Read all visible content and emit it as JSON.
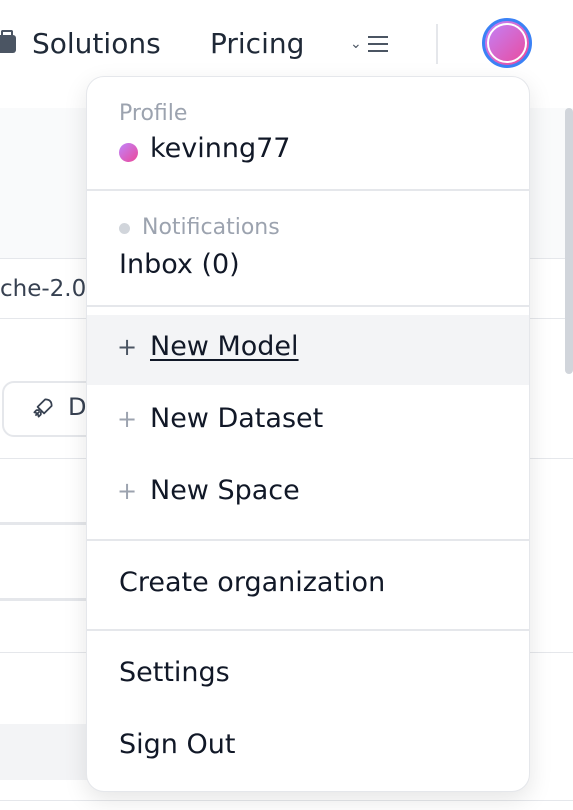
{
  "nav": {
    "solutions_label": "Solutions",
    "pricing_label": "Pricing",
    "menu_chevron": "⌄"
  },
  "background": {
    "repo_text_fragment": "che-2.0",
    "button_fragment": "D"
  },
  "dropdown": {
    "profile": {
      "label": "Profile",
      "username": "kevinng77"
    },
    "notifications": {
      "label": "Notifications",
      "inbox": "Inbox (0)"
    },
    "create": [
      {
        "label": "New Model",
        "icon": "+"
      },
      {
        "label": "New Dataset",
        "icon": "+"
      },
      {
        "label": "New Space",
        "icon": "+"
      }
    ],
    "create_org": "Create organization",
    "settings": "Settings",
    "sign_out": "Sign Out"
  },
  "colors": {
    "accent_ring": "#3b82f6",
    "avatar_gradient_start": "#c084fc",
    "avatar_gradient_end": "#ec4899"
  },
  "icons": [
    "briefcase-icon",
    "chevron-down-icon",
    "hamburger-icon",
    "rocket-icon",
    "plus-icon"
  ]
}
